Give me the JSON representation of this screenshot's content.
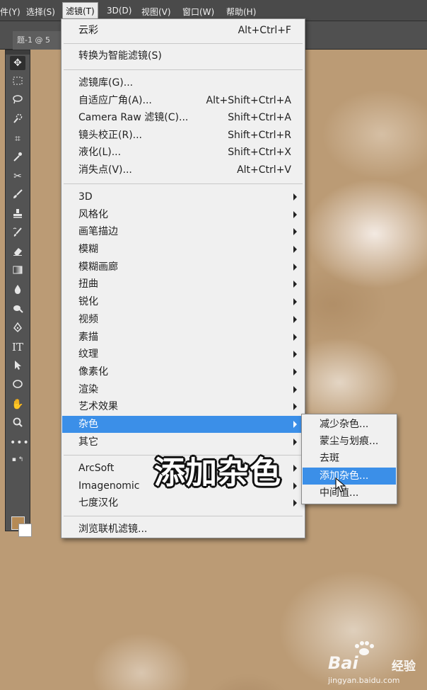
{
  "menubar": {
    "items": [
      "件(Y)",
      "选择(S)",
      "滤镜(T)",
      "3D(D)",
      "视图(V)",
      "窗口(W)",
      "帮助(H)"
    ]
  },
  "document": {
    "tab_title": "题-1 @ 5"
  },
  "filter_menu": {
    "items": [
      {
        "label": "云彩",
        "shortcut": "Alt+Ctrl+F"
      },
      {
        "label": "转换为智能滤镜(S)"
      },
      {
        "label": "滤镜库(G)..."
      },
      {
        "label": "自适应广角(A)...",
        "shortcut": "Alt+Shift+Ctrl+A"
      },
      {
        "label": "Camera Raw 滤镜(C)...",
        "shortcut": "Shift+Ctrl+A"
      },
      {
        "label": "镜头校正(R)...",
        "shortcut": "Shift+Ctrl+R"
      },
      {
        "label": "液化(L)...",
        "shortcut": "Shift+Ctrl+X"
      },
      {
        "label": "消失点(V)...",
        "shortcut": "Alt+Ctrl+V"
      },
      {
        "label": "3D"
      },
      {
        "label": "风格化"
      },
      {
        "label": "画笔描边"
      },
      {
        "label": "模糊"
      },
      {
        "label": "模糊画廊"
      },
      {
        "label": "扭曲"
      },
      {
        "label": "锐化"
      },
      {
        "label": "视频"
      },
      {
        "label": "素描"
      },
      {
        "label": "纹理"
      },
      {
        "label": "像素化"
      },
      {
        "label": "渲染"
      },
      {
        "label": "艺术效果"
      },
      {
        "label": "杂色"
      },
      {
        "label": "其它"
      },
      {
        "label": "ArcSoft"
      },
      {
        "label": "Imagenomic"
      },
      {
        "label": "七度汉化"
      },
      {
        "label": "浏览联机滤镜..."
      }
    ]
  },
  "noise_submenu": {
    "items": [
      "减少杂色...",
      "蒙尘与划痕...",
      "去斑",
      "添加杂色...",
      "中间值..."
    ]
  },
  "caption": "添加杂色",
  "watermark": {
    "brand": "Bai",
    "brand2": "经验",
    "url": "jingyan.baidu.com"
  },
  "colors": {
    "menu_bg": "#f0f0f0",
    "highlight": "#3b8fe8",
    "canvas": "#bb9b75",
    "foreground_swatch": "#b58a55",
    "background_swatch": "#ffffff"
  },
  "icons": [
    "move-icon",
    "marquee-icon",
    "lasso-icon",
    "quick-select-icon",
    "crop-icon",
    "eyedropper-icon",
    "healing-icon",
    "brush-icon",
    "stamp-icon",
    "history-brush-icon",
    "eraser-icon",
    "gradient-icon",
    "blur-icon",
    "dodge-icon",
    "pen-icon",
    "type-icon",
    "path-select-icon",
    "shape-icon",
    "hand-icon",
    "zoom-icon",
    "more-tools-icon"
  ]
}
